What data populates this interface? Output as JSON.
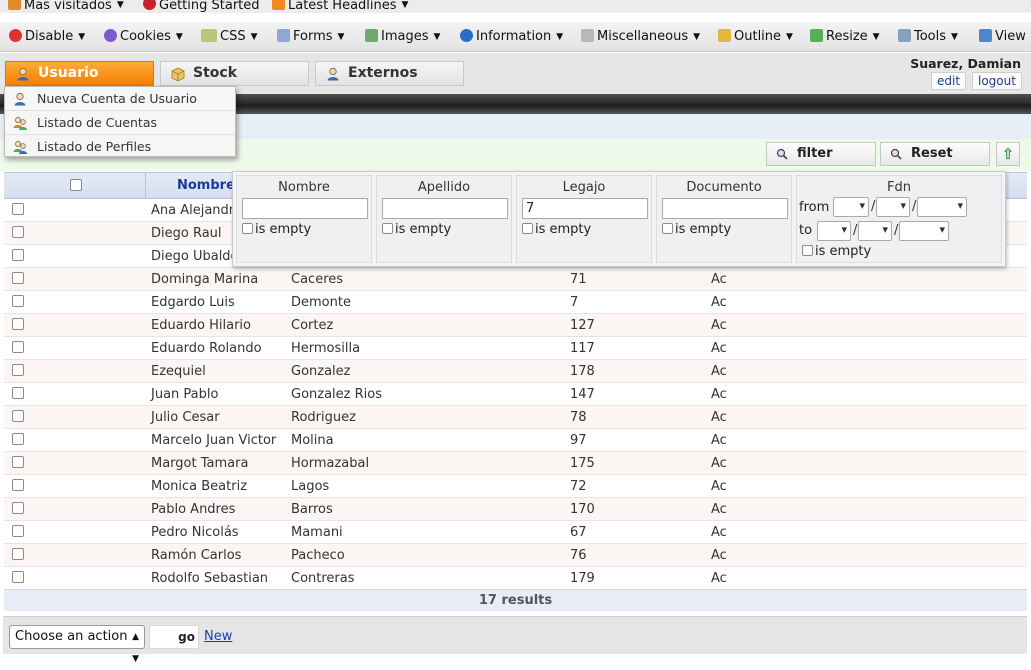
{
  "bookmarks": {
    "items": [
      {
        "label": "Mas visitados",
        "has_menu": true,
        "icon": "most-visited-icon"
      },
      {
        "label": "Getting Started",
        "has_menu": false,
        "icon": "firefox-icon"
      },
      {
        "label": "Latest Headlines",
        "has_menu": true,
        "icon": "rss-icon"
      }
    ]
  },
  "devbar": {
    "items": [
      {
        "label": "Disable",
        "icon": "disable-icon"
      },
      {
        "label": "Cookies",
        "icon": "cookies-icon"
      },
      {
        "label": "CSS",
        "icon": "css-icon"
      },
      {
        "label": "Forms",
        "icon": "forms-icon"
      },
      {
        "label": "Images",
        "icon": "images-icon"
      },
      {
        "label": "Information",
        "icon": "information-icon"
      },
      {
        "label": "Miscellaneous",
        "icon": "miscellaneous-icon"
      },
      {
        "label": "Outline",
        "icon": "outline-icon"
      },
      {
        "label": "Resize",
        "icon": "resize-icon"
      },
      {
        "label": "Tools",
        "icon": "tools-icon"
      },
      {
        "label": "View",
        "icon": "view-icon"
      }
    ]
  },
  "header": {
    "tabs": [
      {
        "label": "Usuario",
        "active": true,
        "icon": "user-icon"
      },
      {
        "label": "Stock",
        "active": false,
        "icon": "box-icon"
      },
      {
        "label": "Externos",
        "active": false,
        "icon": "user-icon"
      }
    ],
    "user_name": "Suarez, Damian",
    "edit_label": "edit",
    "logout_label": "logout"
  },
  "usuario_menu": {
    "items": [
      {
        "label": "Nueva Cuenta de Usuario",
        "icon": "new-user-icon"
      },
      {
        "label": "Listado de Cuentas",
        "icon": "users-list-icon"
      },
      {
        "label": "Listado de Perfiles",
        "icon": "profiles-icon"
      }
    ]
  },
  "toolbar": {
    "filter_label": "filter",
    "reset_label": "Reset",
    "up_label": "⇧"
  },
  "filter_popup": {
    "nombre": {
      "label": "Nombre",
      "value": ""
    },
    "apellido": {
      "label": "Apellido",
      "value": ""
    },
    "legajo": {
      "label": "Legajo",
      "value": "7"
    },
    "documento": {
      "label": "Documento",
      "value": ""
    },
    "fdn": {
      "label": "Fdn",
      "from_label": "from",
      "to_label": "to"
    },
    "is_empty_label": "is empty",
    "date_sep": "/"
  },
  "table": {
    "name_header": "Nombre",
    "rows": [
      {
        "nombre": "Ana Alejandra",
        "apellido": "",
        "legajo": "",
        "documento": ""
      },
      {
        "nombre": "Diego Raul",
        "apellido": "",
        "legajo": "",
        "documento": ""
      },
      {
        "nombre": "Diego Ubaldo",
        "apellido": "",
        "legajo": "",
        "documento": ""
      },
      {
        "nombre": "Dominga Marina",
        "apellido": "Caceres",
        "legajo": "71",
        "documento": "Ac"
      },
      {
        "nombre": "Edgardo Luis",
        "apellido": "Demonte",
        "legajo": "7",
        "documento": "Ac"
      },
      {
        "nombre": "Eduardo Hilario",
        "apellido": "Cortez",
        "legajo": "127",
        "documento": "Ac"
      },
      {
        "nombre": "Eduardo Rolando",
        "apellido": "Hermosilla",
        "legajo": "117",
        "documento": "Ac"
      },
      {
        "nombre": "Ezequiel",
        "apellido": "Gonzalez",
        "legajo": "178",
        "documento": "Ac"
      },
      {
        "nombre": "Juan Pablo",
        "apellido": "Gonzalez Rios",
        "legajo": "147",
        "documento": "Ac"
      },
      {
        "nombre": "Julio Cesar",
        "apellido": "Rodriguez",
        "legajo": "78",
        "documento": "Ac"
      },
      {
        "nombre": "Marcelo Juan Victor",
        "apellido": "Molina",
        "legajo": "97",
        "documento": "Ac"
      },
      {
        "nombre": "Margot Tamara",
        "apellido": "Hormazabal",
        "legajo": "175",
        "documento": "Ac"
      },
      {
        "nombre": "Monica Beatriz",
        "apellido": "Lagos",
        "legajo": "72",
        "documento": "Ac"
      },
      {
        "nombre": "Pablo Andres",
        "apellido": "Barros",
        "legajo": "170",
        "documento": "Ac"
      },
      {
        "nombre": "Pedro Nicolás",
        "apellido": "Mamani",
        "legajo": "67",
        "documento": "Ac"
      },
      {
        "nombre": "Ramón Carlos",
        "apellido": "Pacheco",
        "legajo": "76",
        "documento": "Ac"
      },
      {
        "nombre": "Rodolfo Sebastian",
        "apellido": "Contreras",
        "legajo": "179",
        "documento": "Ac"
      }
    ],
    "results_label": "17 results"
  },
  "footer": {
    "action_placeholder": "Choose an action",
    "go_label": "go",
    "new_label": "New"
  },
  "colors": {
    "active_tab": "#f47f00",
    "link": "#1a3faf",
    "header_text": "#1a3a9a"
  }
}
